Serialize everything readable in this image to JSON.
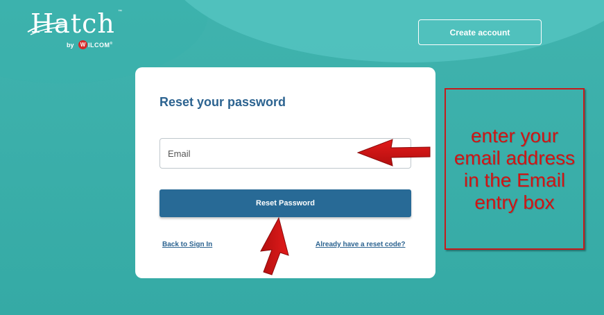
{
  "logo": {
    "word": "Hatch",
    "tm": "™",
    "by": "by",
    "badge_letter": "W",
    "company": "ILCOM",
    "tm2": "®"
  },
  "header": {
    "create_account_label": "Create account"
  },
  "card": {
    "title": "Reset your password",
    "email_placeholder": "Email",
    "reset_button_label": "Reset Password",
    "back_link": "Back to Sign In",
    "code_link": "Already have a reset code?"
  },
  "annotation": {
    "text": "enter your email address in the Email entry box",
    "color": "#d01414"
  },
  "colors": {
    "background": "#3aafaa",
    "primary": "#286a96",
    "title": "#2c6390"
  }
}
